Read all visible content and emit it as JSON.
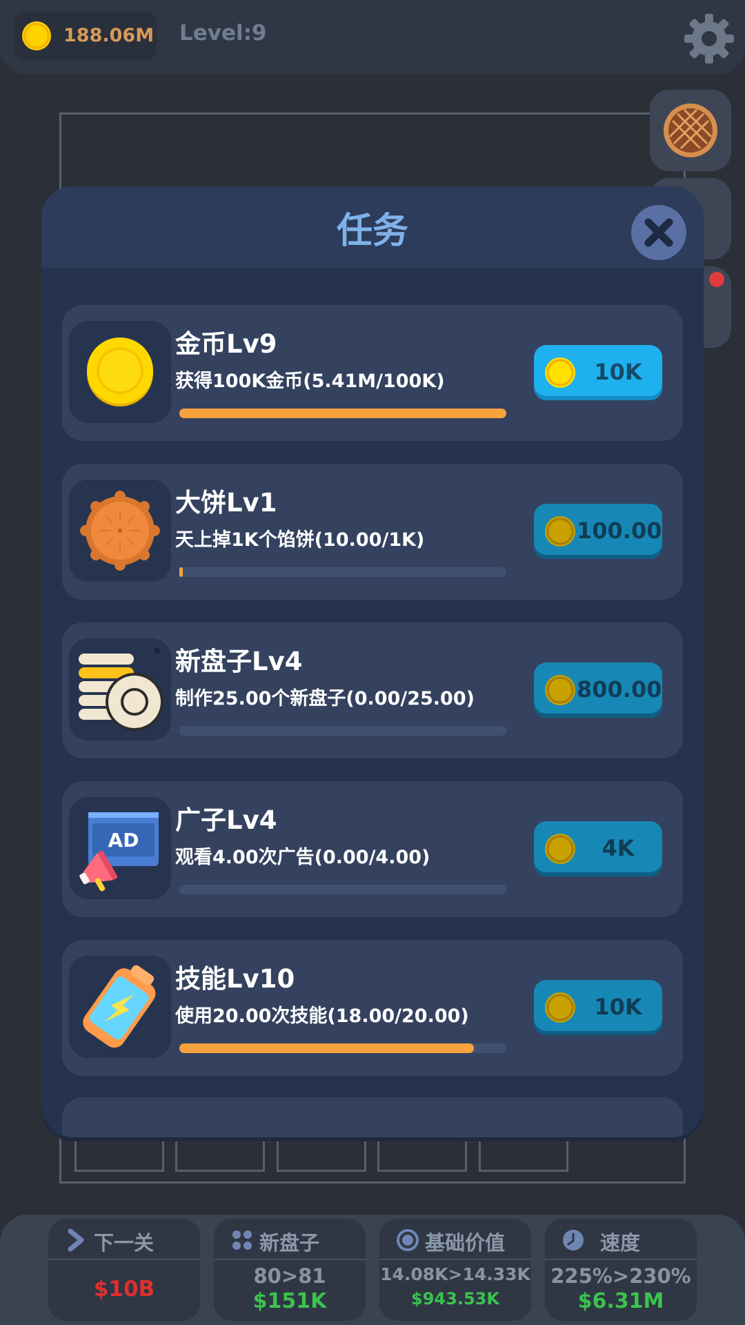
{
  "top_bar": {
    "coins": "188.06M",
    "level": "Level:9",
    "settings_icon": "gear-icon"
  },
  "modal": {
    "title": "任务",
    "close_icon": "close-icon",
    "tasks": [
      {
        "title": "金币Lv9",
        "desc": "获得100K金币(5.41M/100K)",
        "progress": 1.0,
        "reward": "10K",
        "claimable": true,
        "icon": "gold-coin-icon"
      },
      {
        "title": "大饼Lv1",
        "desc": "天上掉1K个馅饼(10.00/1K)",
        "progress": 0.01,
        "reward": "100.00",
        "claimable": false,
        "icon": "mooncake-icon"
      },
      {
        "title": "新盘子Lv4",
        "desc": "制作25.00个新盘子(0.00/25.00)",
        "progress": 0.0,
        "reward": "800.00",
        "claimable": false,
        "icon": "plates-icon"
      },
      {
        "title": "广子Lv4",
        "desc": "观看4.00次广告(0.00/4.00)",
        "progress": 0.0,
        "reward": "4K",
        "claimable": false,
        "icon": "ad-megaphone-icon",
        "icon_text": "AD"
      },
      {
        "title": "技能Lv10",
        "desc": "使用20.00次技能(18.00/20.00)",
        "progress": 0.9,
        "reward": "10K",
        "claimable": false,
        "icon": "battery-icon"
      }
    ]
  },
  "bottom_bar": {
    "next_level": {
      "label": "下一关",
      "value": "$10B",
      "icon": "chevron-right-icon"
    },
    "new_plate": {
      "label": "新盘子",
      "line1": "80>81",
      "line2": "$151K",
      "icon": "dots-icon"
    },
    "base_value": {
      "label": "基础价值",
      "line1": "14.08K>14.33K",
      "line2": "$943.53K",
      "icon": "target-icon"
    },
    "speed": {
      "label": "速度",
      "line1": "225%>230%",
      "line2": "$6.31M",
      "icon": "clock-icon"
    }
  },
  "colors": {
    "accent_blue": "#1fb1ee",
    "progress_orange": "#f6a33d",
    "coin_gold": "#ffd200",
    "money_green": "#3cc24f",
    "money_red": "#e02f2f"
  }
}
